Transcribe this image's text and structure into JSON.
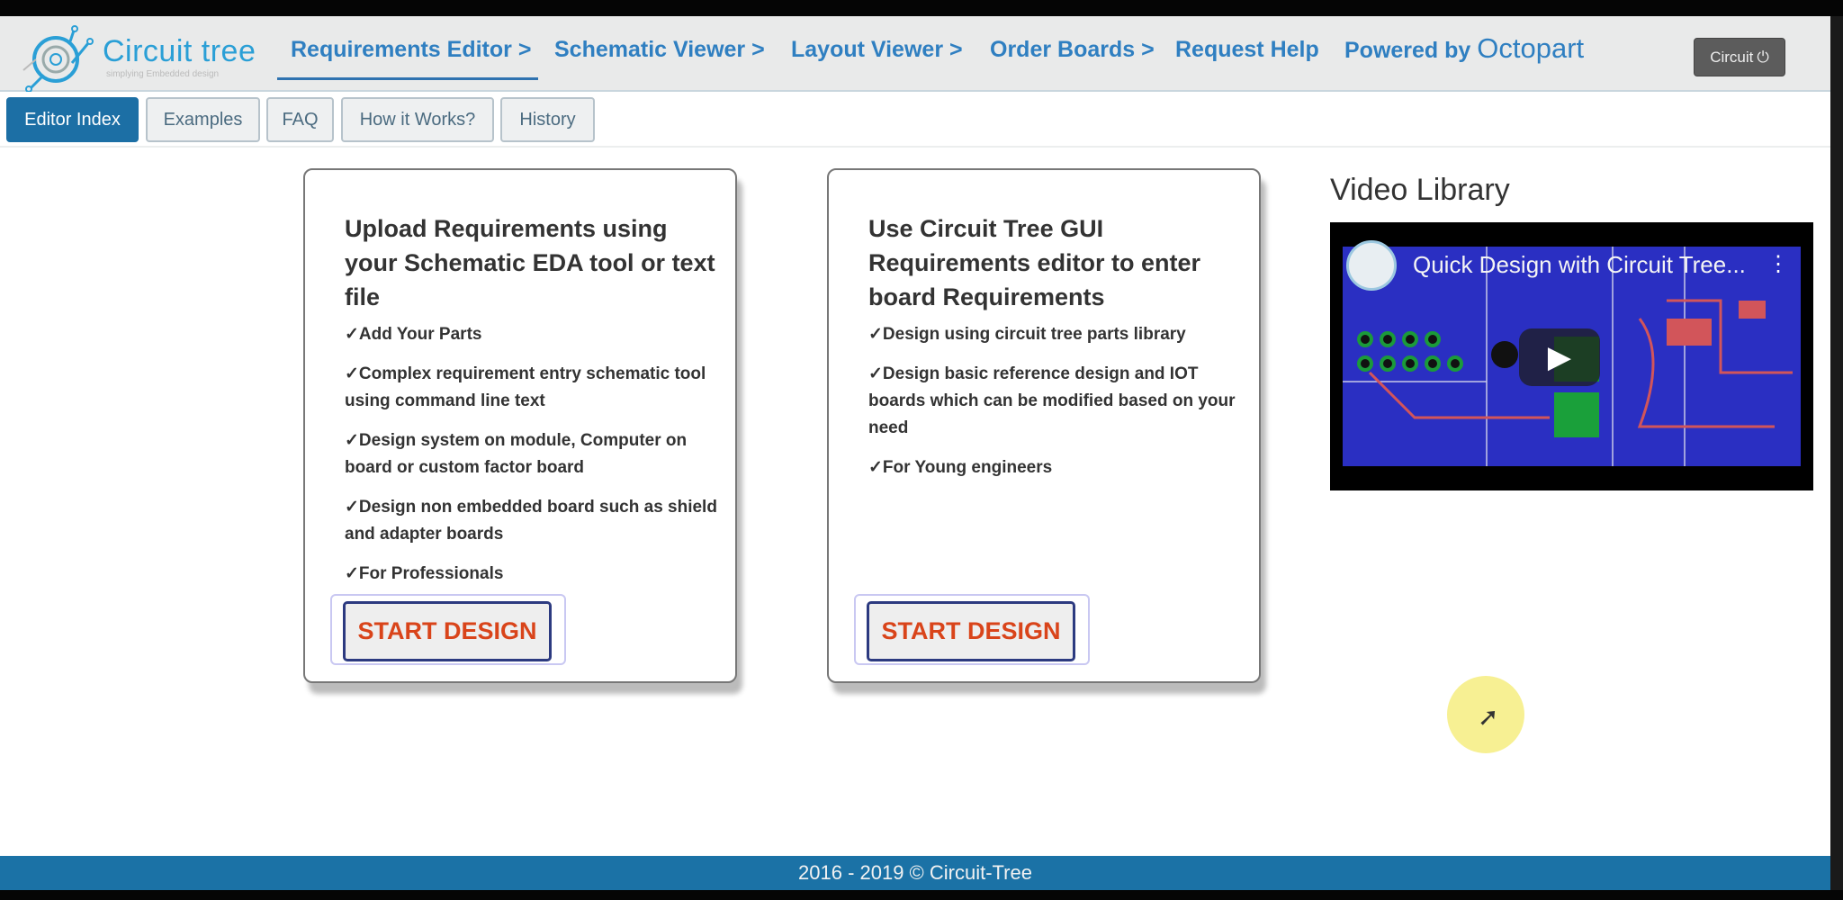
{
  "header": {
    "logo_text": "Circuit tree",
    "logo_tagline": "simplying Embedded design",
    "nav": [
      {
        "label": "Requirements Editor >",
        "active": true
      },
      {
        "label": "Schematic Viewer >"
      },
      {
        "label": "Layout Viewer >"
      },
      {
        "label": "Order Boards >"
      },
      {
        "label": "Request Help"
      }
    ],
    "powered_by": "Powered by",
    "powered_brand": "Octopart",
    "user_button": "Circuit",
    "user_icon": "power-icon"
  },
  "subnav": [
    {
      "label": "Editor Index",
      "active": true
    },
    {
      "label": "Examples"
    },
    {
      "label": "FAQ"
    },
    {
      "label": "How it Works?"
    },
    {
      "label": "History"
    }
  ],
  "cards": [
    {
      "title": "Upload Requirements using your Schematic EDA tool or text file",
      "bullets": [
        "✓Add Your Parts",
        "✓Complex requirement entry schematic tool using command line text",
        "✓Design system on module, Computer on board or custom factor board",
        "✓Design non embedded board such as shield and adapter boards",
        "✓For Professionals"
      ],
      "button": "START DESIGN"
    },
    {
      "title": "Use Circuit Tree GUI Requirements editor to enter board Requirements",
      "bullets": [
        "✓Design using circuit tree parts library",
        "✓Design basic reference design and IOT boards which can be modified based on your need",
        "✓For Young engineers"
      ],
      "button": "START DESIGN"
    }
  ],
  "video_library": {
    "title": "Video Library",
    "video_title": "Quick Design with Circuit Tree..."
  },
  "footer": {
    "text": "2016 - 2019 © Circuit-Tree"
  },
  "colors": {
    "brand": "#1b72a6",
    "nav": "#2f7fc1",
    "button_text": "#d9441a"
  }
}
